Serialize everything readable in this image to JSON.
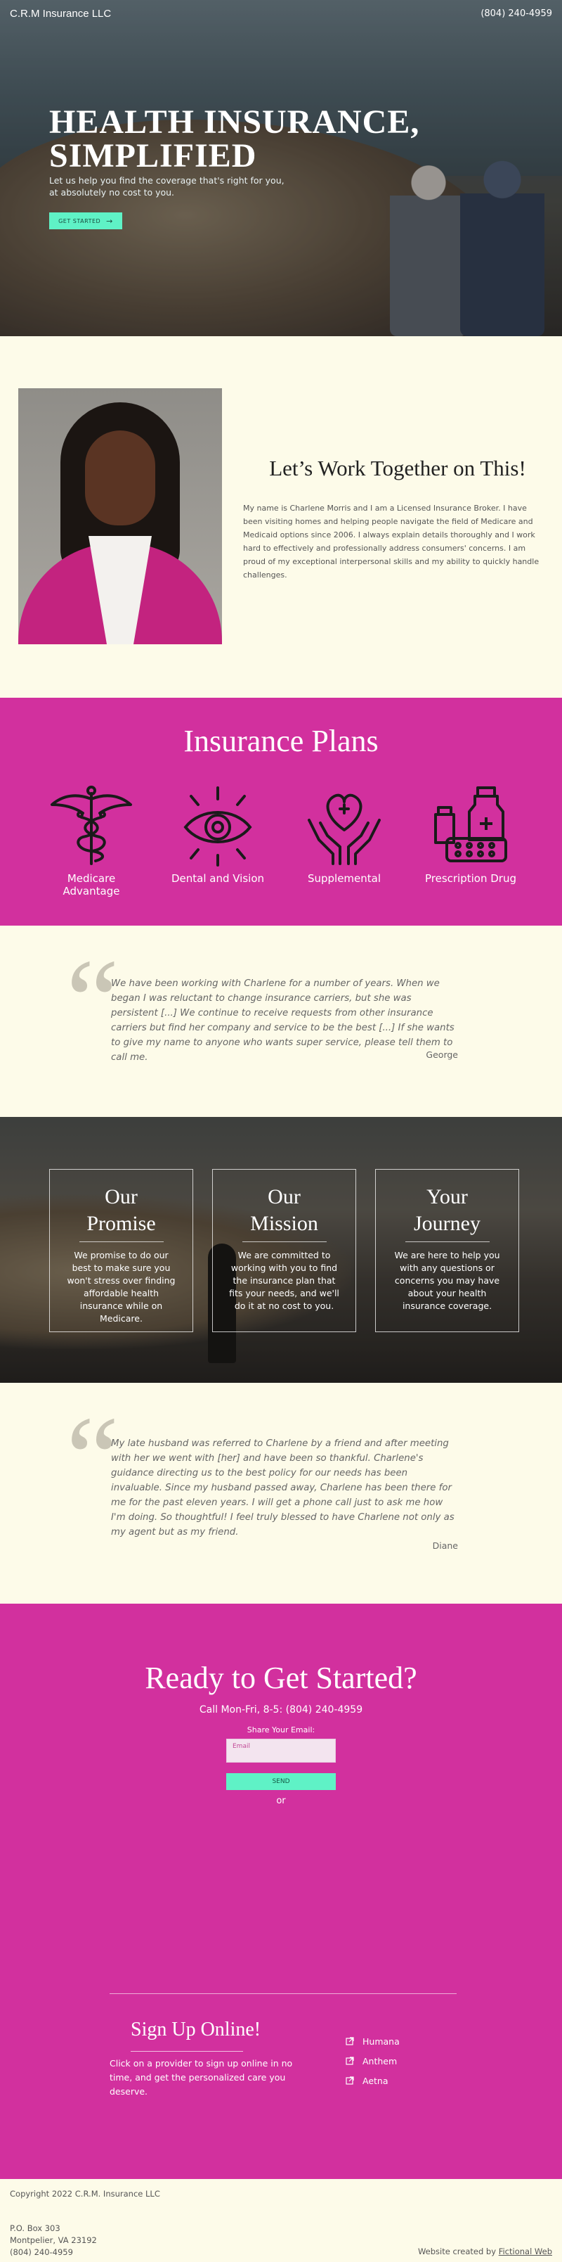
{
  "topbar": {
    "brand": "C.R.M Insurance LLC",
    "phone": "(804) 240-4959"
  },
  "hero": {
    "title_line1": "HEALTH INSURANCE,",
    "title_line2": "SIMPLIFIED",
    "subtitle_line1": "Let us help you find the coverage that's right for you,",
    "subtitle_line2": "at absolutely no cost to you.",
    "cta_label": "GET STARTED",
    "cta_icon": "arrow-right-icon"
  },
  "about": {
    "heading": "Let’s Work Together on This!",
    "body": "My name is Charlene Morris and I am a Licensed Insurance Broker. I have been visiting homes and helping people navigate the field of Medicare and Medicaid options since 2006. I always explain details thoroughly and I work hard to effectively and professionally address consumers' concerns. I am proud of my exceptional interpersonal skills and my ability to quickly handle challenges."
  },
  "plans": {
    "heading": "Insurance Plans",
    "items": [
      {
        "label_line1": "Medicare",
        "label_line2": "Advantage",
        "icon": "caduceus-icon"
      },
      {
        "label_line1": "Dental and Vision",
        "label_line2": "",
        "icon": "eye-icon"
      },
      {
        "label_line1": "Supplemental",
        "label_line2": "",
        "icon": "heart-hands-icon"
      },
      {
        "label_line1": "Prescription Drug",
        "label_line2": "",
        "icon": "pill-bottles-icon"
      }
    ]
  },
  "testimonials": [
    {
      "text": "We have been working with Charlene for a number of years. When we began I was reluctant to change insurance carriers, but she was persistent [...] We continue to receive requests from other insurance carriers but find her company and service to be the best [...] If she wants to give my name to anyone who wants super service, please tell them to call me.",
      "author": "George"
    },
    {
      "text": "My late husband was referred to Charlene by a friend and after meeting with her we went with [her] and have been so thankful. Charlene's guidance directing us to the best policy for our needs has been invaluable. Since my husband passed away, Charlene has been there for me for the past eleven years. I will get a phone call just to ask me how I'm doing. So thoughtful! I feel truly blessed to have Charlene not only as my agent but as my friend.",
      "author": "Diane"
    }
  ],
  "promise": {
    "cards": [
      {
        "title_line1": "Our",
        "title_line2": "Promise",
        "text": "We promise to do our best to make sure you won't stress over finding affordable health insurance while on Medicare."
      },
      {
        "title_line1": "Our",
        "title_line2": "Mission",
        "text": "We are committed to working with you to find the insurance plan that fits your needs, and we'll do it at no cost to you."
      },
      {
        "title_line1": "Your",
        "title_line2": "Journey",
        "text": "We are here to help you with any questions or concerns you may have about your health insurance coverage."
      }
    ]
  },
  "ready": {
    "heading": "Ready to Get Started?",
    "call": "Call Mon-Fri, 8-5: (804) 240-4959",
    "share_label": "Share Your Email:",
    "email_placeholder": "Email",
    "send_label": "SEND",
    "or_label": "or"
  },
  "signup": {
    "title": "Sign Up Online!",
    "text": "Click on a provider to sign up online in no time, and get the personalized care you deserve.",
    "providers": [
      "Humana",
      "Anthem",
      "Aetna"
    ],
    "provider_icon": "external-link-icon"
  },
  "footer": {
    "copyright": "Copyright 2022 C.R.M. Insurance LLC",
    "address_line1": "P.O. Box 303",
    "address_line2": "Montpelier, VA 23192",
    "phone": "(804) 240-4959",
    "credit_prefix": "Website created by ",
    "credit_link": "Fictional Web"
  },
  "colors": {
    "magenta": "#d2309e",
    "mint": "#5ff2c6",
    "cream": "#fdfbe9"
  }
}
